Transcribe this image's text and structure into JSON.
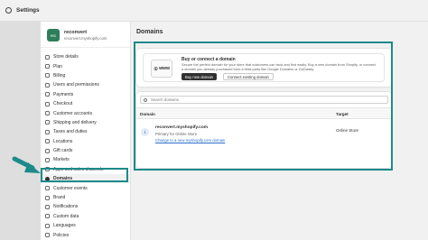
{
  "window": {
    "title": "Settings"
  },
  "store": {
    "initials": "rec",
    "name": "reconvert",
    "domain": "reconvert.myshopify.com"
  },
  "sidebar": {
    "items": [
      {
        "label": "Store details",
        "icon": "store-icon"
      },
      {
        "label": "Plan",
        "icon": "plan-icon"
      },
      {
        "label": "Billing",
        "icon": "billing-icon"
      },
      {
        "label": "Users and permissions",
        "icon": "users-icon"
      },
      {
        "label": "Payments",
        "icon": "payments-icon"
      },
      {
        "label": "Checkout",
        "icon": "checkout-icon"
      },
      {
        "label": "Customer accounts",
        "icon": "customer-accounts-icon"
      },
      {
        "label": "Shipping and delivery",
        "icon": "shipping-icon"
      },
      {
        "label": "Taxes and duties",
        "icon": "taxes-icon"
      },
      {
        "label": "Locations",
        "icon": "locations-icon"
      },
      {
        "label": "Gift cards",
        "icon": "gift-cards-icon"
      },
      {
        "label": "Markets",
        "icon": "markets-icon"
      },
      {
        "label": "Apps and sales channels",
        "icon": "apps-icon"
      },
      {
        "label": "Domains",
        "icon": "globe-icon",
        "active": true
      },
      {
        "label": "Customer events",
        "icon": "customer-events-icon"
      },
      {
        "label": "Brand",
        "icon": "brand-icon"
      },
      {
        "label": "Notifications",
        "icon": "bell-icon"
      },
      {
        "label": "Custom data",
        "icon": "custom-data-icon"
      },
      {
        "label": "Languages",
        "icon": "languages-icon"
      },
      {
        "label": "Policies",
        "icon": "policies-icon"
      }
    ]
  },
  "main": {
    "title": "Domains",
    "buy_card": {
      "logo_text": "www",
      "title": "Buy or connect a domain",
      "description": "Secure the perfect domain for your store that customers can trust and find easily. Buy a new domain from Shopify, or connect a domain you already purchased from a third-party like Google Domains or GoDaddy.",
      "primary_button": "Buy new domain",
      "secondary_button": "Connect existing domain"
    },
    "domains_card": {
      "search_placeholder": "Search domains",
      "columns": [
        "Domain",
        "Target"
      ],
      "rows": [
        {
          "name": "reconvert.myshopify.com",
          "subtitle": "Primary for Online Store",
          "link": "Change to a new myshopify.com domain",
          "target": "Online Store"
        }
      ]
    }
  },
  "colors": {
    "highlight": "#1c8a8a",
    "link": "#2c6ecb",
    "primary_button": "#303030"
  }
}
